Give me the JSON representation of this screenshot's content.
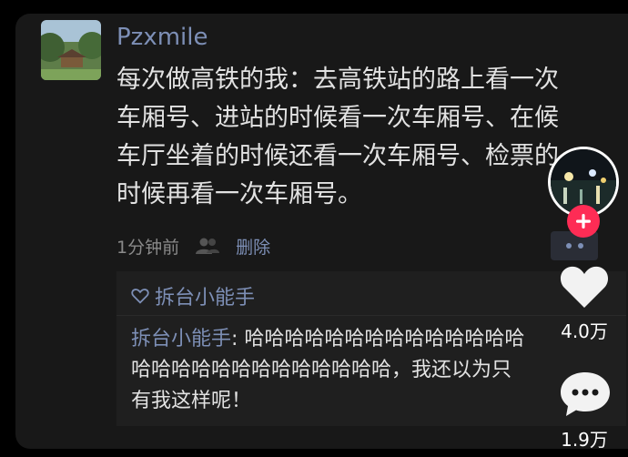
{
  "post": {
    "username": "Pzxmile",
    "text_lines": [
      "每次做高铁的我：去高铁站的路上看一次",
      "车厢号、进站的时候看一次车厢号、在候",
      "车厅坐着的时候还看一次车厢号、检票的",
      "时候再看一次车厢号。"
    ],
    "time": "1分钟前",
    "delete_label": "删除"
  },
  "likes": {
    "names": "拆台小能手"
  },
  "reply": {
    "author": "拆台小能手",
    "separator": ": ",
    "line1_text": "哈哈哈哈哈哈哈哈哈哈哈哈哈哈",
    "line2": "哈哈哈哈哈哈哈哈哈哈哈哈哈，我还以为只",
    "line3": "有我这样呢！"
  },
  "sidebar": {
    "like_count": "4.0万",
    "comment_count": "1.9万"
  },
  "colors": {
    "background": "#000000",
    "card": "#181818",
    "link_blue": "#7d8fb6",
    "follow_red": "#fe2c55"
  },
  "icons": {
    "likes": "heart-outline-icon",
    "people": "people-icon",
    "follow": "plus-icon",
    "like": "heart-icon",
    "comment": "comment-bubble-icon"
  }
}
